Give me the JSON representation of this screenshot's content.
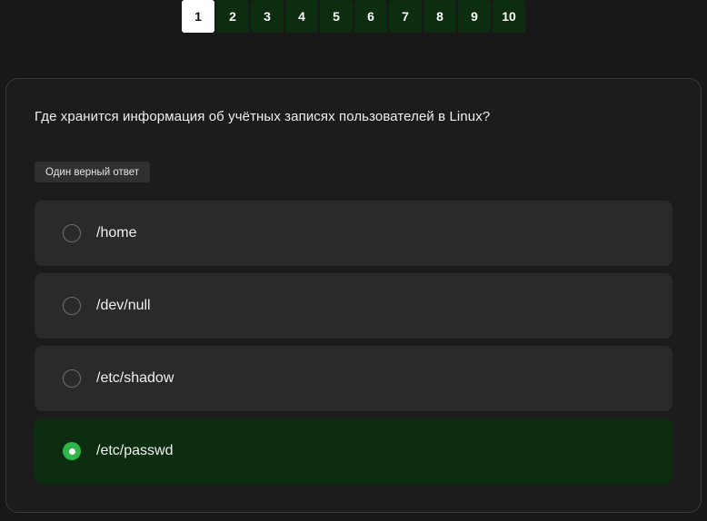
{
  "pagination": {
    "pages": [
      "1",
      "2",
      "3",
      "4",
      "5",
      "6",
      "7",
      "8",
      "9",
      "10"
    ],
    "current": "1"
  },
  "question": {
    "text": "Где хранится информация об учётных записях пользователей в Linux?",
    "badge": "Один верный ответ"
  },
  "options": [
    {
      "label": "/home",
      "selected": false
    },
    {
      "label": "/dev/null",
      "selected": false
    },
    {
      "label": "/etc/shadow",
      "selected": false
    },
    {
      "label": "/etc/passwd",
      "selected": true
    }
  ],
  "colors": {
    "page_background": "#181818",
    "card_background": "#1c1c1c",
    "option_background": "#2a2a2a",
    "selected_background": "#0c2d10",
    "selected_radio": "#2fb64a",
    "page_button": "#0c2d10",
    "active_page_button": "#ffffff"
  },
  "icons": {
    "radio_unchecked": "radio-unchecked-icon",
    "radio_checked": "radio-checked-icon"
  }
}
